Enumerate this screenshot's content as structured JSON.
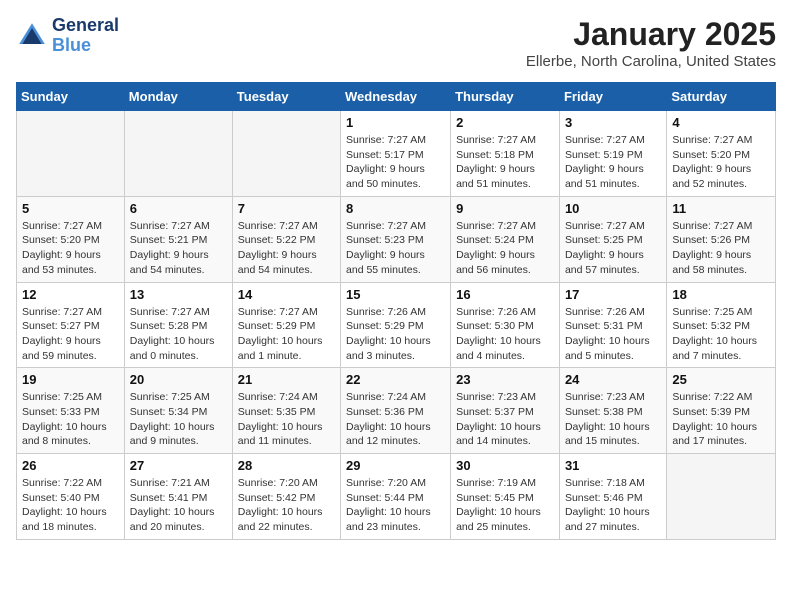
{
  "header": {
    "logo_line1": "General",
    "logo_line2": "Blue",
    "month": "January 2025",
    "location": "Ellerbe, North Carolina, United States"
  },
  "weekdays": [
    "Sunday",
    "Monday",
    "Tuesday",
    "Wednesday",
    "Thursday",
    "Friday",
    "Saturday"
  ],
  "weeks": [
    [
      {
        "day": "",
        "info": ""
      },
      {
        "day": "",
        "info": ""
      },
      {
        "day": "",
        "info": ""
      },
      {
        "day": "1",
        "info": "Sunrise: 7:27 AM\nSunset: 5:17 PM\nDaylight: 9 hours\nand 50 minutes."
      },
      {
        "day": "2",
        "info": "Sunrise: 7:27 AM\nSunset: 5:18 PM\nDaylight: 9 hours\nand 51 minutes."
      },
      {
        "day": "3",
        "info": "Sunrise: 7:27 AM\nSunset: 5:19 PM\nDaylight: 9 hours\nand 51 minutes."
      },
      {
        "day": "4",
        "info": "Sunrise: 7:27 AM\nSunset: 5:20 PM\nDaylight: 9 hours\nand 52 minutes."
      }
    ],
    [
      {
        "day": "5",
        "info": "Sunrise: 7:27 AM\nSunset: 5:20 PM\nDaylight: 9 hours\nand 53 minutes."
      },
      {
        "day": "6",
        "info": "Sunrise: 7:27 AM\nSunset: 5:21 PM\nDaylight: 9 hours\nand 54 minutes."
      },
      {
        "day": "7",
        "info": "Sunrise: 7:27 AM\nSunset: 5:22 PM\nDaylight: 9 hours\nand 54 minutes."
      },
      {
        "day": "8",
        "info": "Sunrise: 7:27 AM\nSunset: 5:23 PM\nDaylight: 9 hours\nand 55 minutes."
      },
      {
        "day": "9",
        "info": "Sunrise: 7:27 AM\nSunset: 5:24 PM\nDaylight: 9 hours\nand 56 minutes."
      },
      {
        "day": "10",
        "info": "Sunrise: 7:27 AM\nSunset: 5:25 PM\nDaylight: 9 hours\nand 57 minutes."
      },
      {
        "day": "11",
        "info": "Sunrise: 7:27 AM\nSunset: 5:26 PM\nDaylight: 9 hours\nand 58 minutes."
      }
    ],
    [
      {
        "day": "12",
        "info": "Sunrise: 7:27 AM\nSunset: 5:27 PM\nDaylight: 9 hours\nand 59 minutes."
      },
      {
        "day": "13",
        "info": "Sunrise: 7:27 AM\nSunset: 5:28 PM\nDaylight: 10 hours\nand 0 minutes."
      },
      {
        "day": "14",
        "info": "Sunrise: 7:27 AM\nSunset: 5:29 PM\nDaylight: 10 hours\nand 1 minute."
      },
      {
        "day": "15",
        "info": "Sunrise: 7:26 AM\nSunset: 5:29 PM\nDaylight: 10 hours\nand 3 minutes."
      },
      {
        "day": "16",
        "info": "Sunrise: 7:26 AM\nSunset: 5:30 PM\nDaylight: 10 hours\nand 4 minutes."
      },
      {
        "day": "17",
        "info": "Sunrise: 7:26 AM\nSunset: 5:31 PM\nDaylight: 10 hours\nand 5 minutes."
      },
      {
        "day": "18",
        "info": "Sunrise: 7:25 AM\nSunset: 5:32 PM\nDaylight: 10 hours\nand 7 minutes."
      }
    ],
    [
      {
        "day": "19",
        "info": "Sunrise: 7:25 AM\nSunset: 5:33 PM\nDaylight: 10 hours\nand 8 minutes."
      },
      {
        "day": "20",
        "info": "Sunrise: 7:25 AM\nSunset: 5:34 PM\nDaylight: 10 hours\nand 9 minutes."
      },
      {
        "day": "21",
        "info": "Sunrise: 7:24 AM\nSunset: 5:35 PM\nDaylight: 10 hours\nand 11 minutes."
      },
      {
        "day": "22",
        "info": "Sunrise: 7:24 AM\nSunset: 5:36 PM\nDaylight: 10 hours\nand 12 minutes."
      },
      {
        "day": "23",
        "info": "Sunrise: 7:23 AM\nSunset: 5:37 PM\nDaylight: 10 hours\nand 14 minutes."
      },
      {
        "day": "24",
        "info": "Sunrise: 7:23 AM\nSunset: 5:38 PM\nDaylight: 10 hours\nand 15 minutes."
      },
      {
        "day": "25",
        "info": "Sunrise: 7:22 AM\nSunset: 5:39 PM\nDaylight: 10 hours\nand 17 minutes."
      }
    ],
    [
      {
        "day": "26",
        "info": "Sunrise: 7:22 AM\nSunset: 5:40 PM\nDaylight: 10 hours\nand 18 minutes."
      },
      {
        "day": "27",
        "info": "Sunrise: 7:21 AM\nSunset: 5:41 PM\nDaylight: 10 hours\nand 20 minutes."
      },
      {
        "day": "28",
        "info": "Sunrise: 7:20 AM\nSunset: 5:42 PM\nDaylight: 10 hours\nand 22 minutes."
      },
      {
        "day": "29",
        "info": "Sunrise: 7:20 AM\nSunset: 5:44 PM\nDaylight: 10 hours\nand 23 minutes."
      },
      {
        "day": "30",
        "info": "Sunrise: 7:19 AM\nSunset: 5:45 PM\nDaylight: 10 hours\nand 25 minutes."
      },
      {
        "day": "31",
        "info": "Sunrise: 7:18 AM\nSunset: 5:46 PM\nDaylight: 10 hours\nand 27 minutes."
      },
      {
        "day": "",
        "info": ""
      }
    ]
  ]
}
